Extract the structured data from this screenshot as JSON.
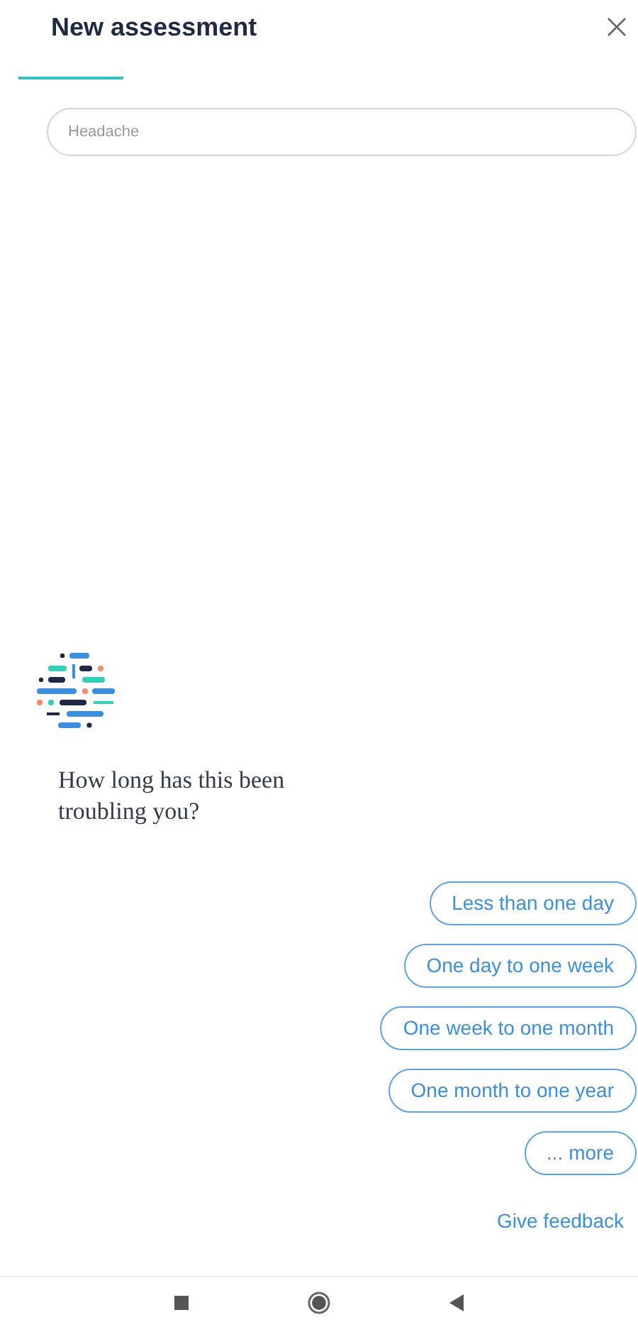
{
  "header": {
    "title": "New assessment"
  },
  "search": {
    "value": "Headache"
  },
  "message": {
    "text": "How long has this been troubling you?"
  },
  "options": [
    {
      "label": "Less than one day"
    },
    {
      "label": "One day to one week"
    },
    {
      "label": "One week to one month"
    },
    {
      "label": "One month to one year"
    },
    {
      "label": "... more"
    }
  ],
  "feedback": {
    "label": "Give feedback"
  }
}
